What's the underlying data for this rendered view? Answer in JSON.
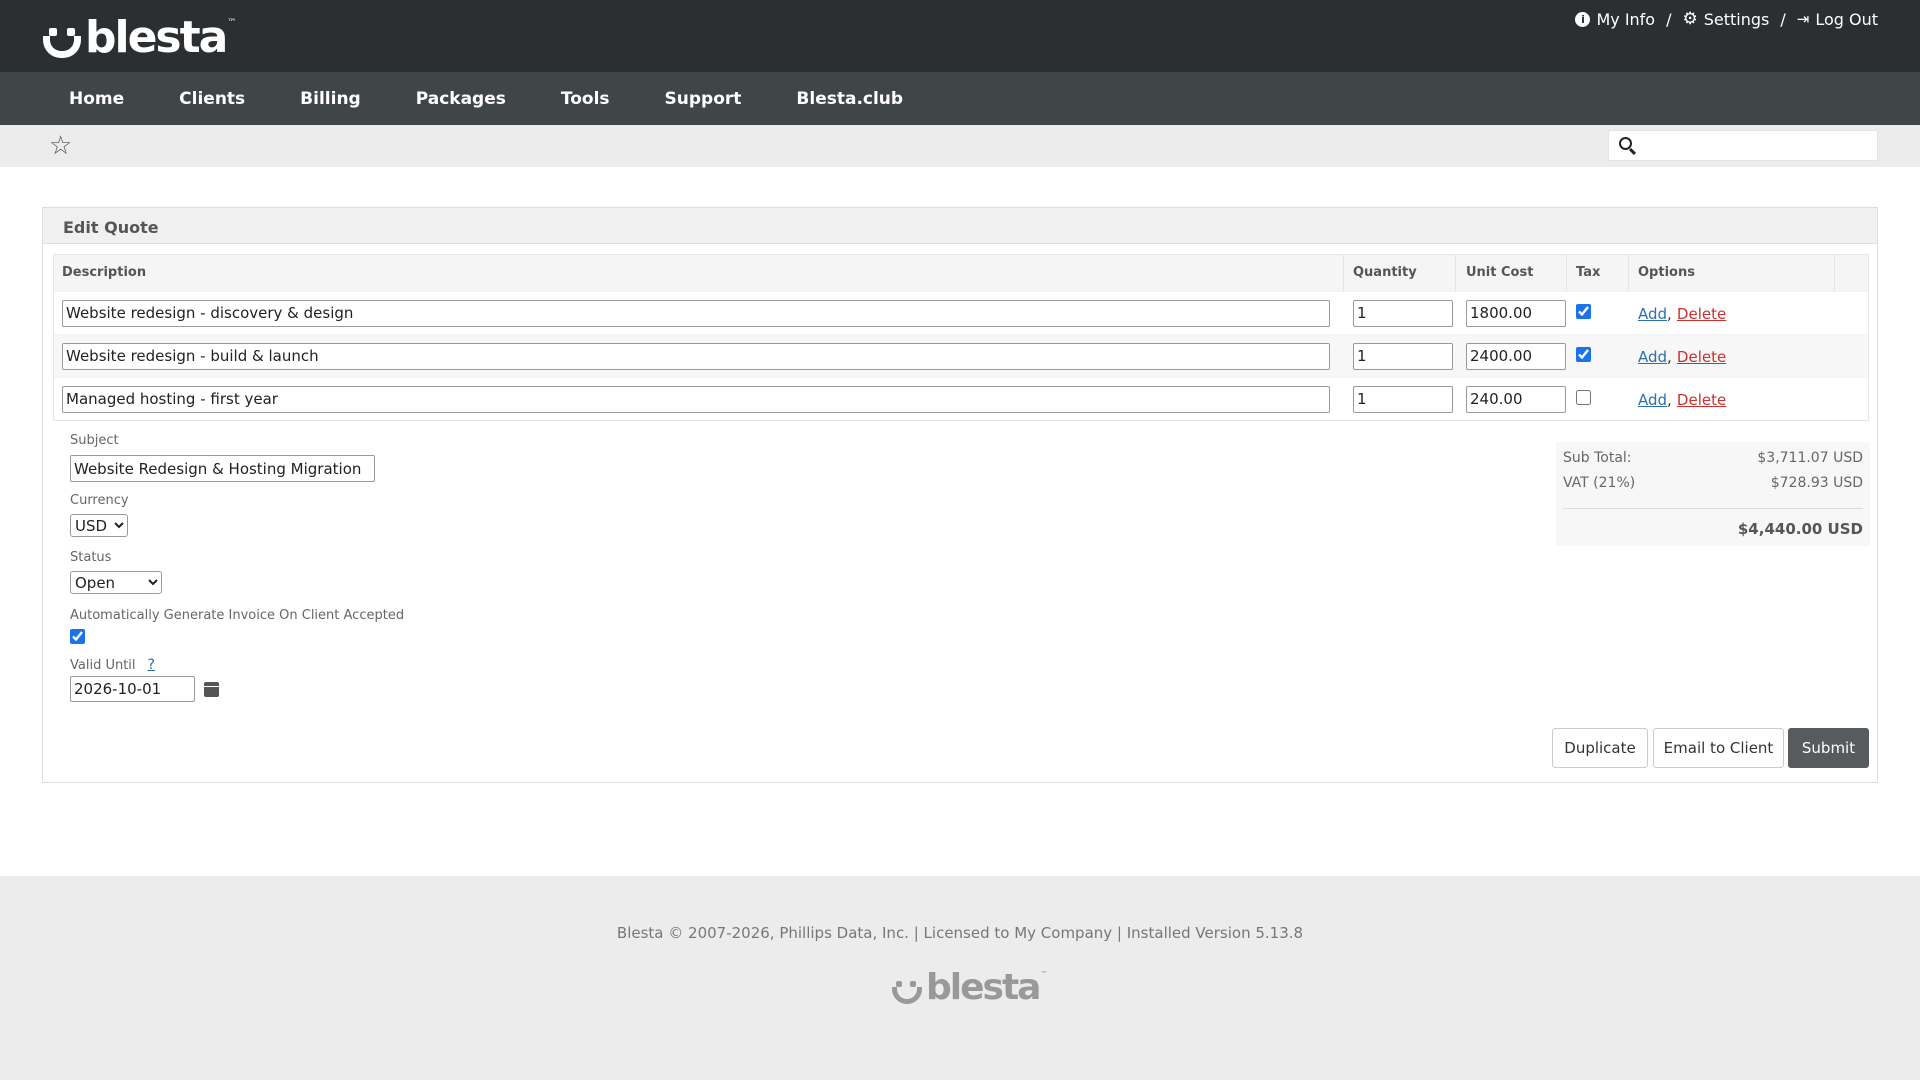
{
  "header": {
    "logo_text": "blesta",
    "logo_tm": "™",
    "links": {
      "my_info": "My Info",
      "settings": "Settings",
      "log_out": "Log Out",
      "separator": "/"
    }
  },
  "nav": {
    "items": [
      "Home",
      "Clients",
      "Billing",
      "Packages",
      "Tools",
      "Support",
      "Blesta.club"
    ]
  },
  "search": {
    "value": "",
    "placeholder": ""
  },
  "panel": {
    "title": "Edit Quote",
    "columns": {
      "description": "Description",
      "quantity": "Quantity",
      "unit_cost": "Unit Cost",
      "tax": "Tax",
      "options": "Options"
    },
    "lines": [
      {
        "description": "Website redesign - discovery & design",
        "quantity": "1",
        "unit_cost": "1800.00",
        "tax": true,
        "add": "Add",
        "delete": "Delete",
        "comma": ","
      },
      {
        "description": "Website redesign - build & launch",
        "quantity": "1",
        "unit_cost": "2400.00",
        "tax": true,
        "add": "Add",
        "delete": "Delete",
        "comma": ","
      },
      {
        "description": "Managed hosting - first year",
        "quantity": "1",
        "unit_cost": "240.00",
        "tax": false,
        "add": "Add",
        "delete": "Delete",
        "comma": ","
      }
    ],
    "subject": {
      "label": "Subject",
      "value": "Website Redesign & Hosting Migration"
    },
    "currency": {
      "label": "Currency",
      "selected": "USD"
    },
    "status": {
      "label": "Status",
      "selected": "Open"
    },
    "auto_invoice": {
      "label": "Automatically Generate Invoice On Client Accepted",
      "checked": true
    },
    "valid_until": {
      "label": "Valid Until",
      "help": "?",
      "value": "2026-10-01"
    },
    "totals": {
      "subtotal_label": "Sub Total:",
      "subtotal_value": "$3,711.07 USD",
      "tax_label": "VAT (21%)",
      "tax_value": "$728.93 USD",
      "total_value": "$4,440.00 USD"
    },
    "buttons": {
      "duplicate": "Duplicate",
      "email": "Email to Client",
      "submit": "Submit"
    }
  },
  "footer": {
    "text": "Blesta © 2007-2026, Phillips Data, Inc. | Licensed to My Company | Installed Version 5.13.8",
    "logo_text": "blesta",
    "logo_tm": "™"
  }
}
